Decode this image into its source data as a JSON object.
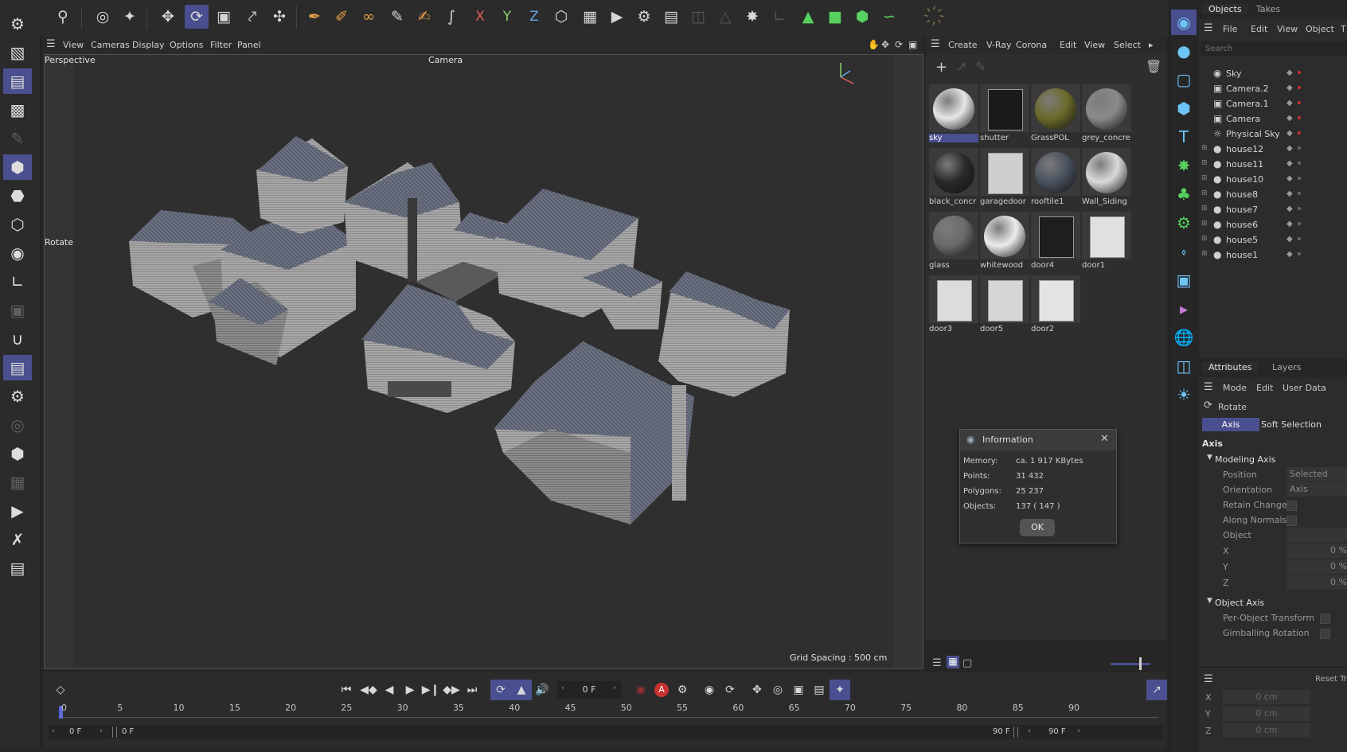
{
  "colors": {
    "accent": "#4a4f8f",
    "bg": "#262626",
    "panel": "#2e2e2e",
    "icon_blue": "#6ec3f5",
    "record_red": "#c8322f"
  },
  "top_toolbar": {
    "icons": [
      "search-icon",
      "live-selection-icon",
      "select-tools-icon",
      "move-icon",
      "rotate-icon",
      "scale-icon",
      "transfer-icon",
      "point-move-icon",
      "spline-pen-icon",
      "spline-paint-icon",
      "spline-arc-icon",
      "brush-icon",
      "sculpt-icon",
      "knife-icon",
      "x-axis-icon",
      "y-axis-icon",
      "z-axis-icon",
      "world-coord-icon",
      "render-region-icon",
      "render-view-icon",
      "render-settings-icon",
      "picture-viewer-icon",
      "snap-icon",
      "workplane-icon",
      "lock-icon",
      "dynamics-icon",
      "camera-icon",
      "cube-icon",
      "spline-icon",
      "geometry-icon",
      "deformer-icon",
      "figure-icon"
    ],
    "xyz": [
      "X",
      "Y",
      "Z"
    ]
  },
  "viewport": {
    "menu": [
      "View",
      "Cameras",
      "Display",
      "Options",
      "Filter",
      "Panel"
    ],
    "view_name": "Perspective",
    "camera_label": "Camera",
    "tool_label": "Rotate",
    "grid_spacing": "Grid Spacing : 500 cm"
  },
  "material_manager": {
    "menu": [
      "Create",
      "V-Ray",
      "Corona",
      "Edit",
      "View",
      "Select"
    ],
    "materials": [
      {
        "name": "sky",
        "color": "#e6e6e6",
        "selected": true
      },
      {
        "name": "shutter",
        "color": "#1a1a1a"
      },
      {
        "name": "GrassPOL",
        "color": "#6b6a2a"
      },
      {
        "name": "grey_concre",
        "color": "#8a8a8a"
      },
      {
        "name": "black_concr",
        "color": "#2a2a2a"
      },
      {
        "name": "garagedoor",
        "color": "#cfcfcf"
      },
      {
        "name": "rooftile1",
        "color": "#4a525e"
      },
      {
        "name": "Wall_Siding",
        "color": "#d9d9d9"
      },
      {
        "name": "glass",
        "color": "#6a6a6a"
      },
      {
        "name": "whitewood",
        "color": "#ececec"
      },
      {
        "name": "door4",
        "color": "#1e1e1e"
      },
      {
        "name": "door1",
        "color": "#e0e0e0"
      },
      {
        "name": "door3",
        "color": "#dcdcdc"
      },
      {
        "name": "door5",
        "color": "#d6d6d6"
      },
      {
        "name": "door2",
        "color": "#e4e4e4"
      }
    ]
  },
  "info_dialog": {
    "title": "Information",
    "rows": [
      {
        "label": "Memory:",
        "value": "ca. 1 917 KBytes"
      },
      {
        "label": "Points:",
        "value": "31 432"
      },
      {
        "label": "Polygons:",
        "value": "25 237"
      },
      {
        "label": "Objects:",
        "value": "137 ( 147 )"
      }
    ],
    "ok_label": "OK"
  },
  "objects_panel": {
    "tabs": [
      "Objects",
      "Takes"
    ],
    "menu": [
      "File",
      "Edit",
      "View",
      "Object",
      "T"
    ],
    "search_placeholder": "Search",
    "items": [
      {
        "name": "Sky",
        "icon": "sky-icon"
      },
      {
        "name": "Camera.2",
        "icon": "camera-icon"
      },
      {
        "name": "Camera.1",
        "icon": "camera-icon"
      },
      {
        "name": "Camera",
        "icon": "camera-icon"
      },
      {
        "name": "Physical Sky",
        "icon": "physical-sky-icon"
      },
      {
        "name": "house12",
        "icon": "null-icon",
        "expandable": true
      },
      {
        "name": "house11",
        "icon": "null-icon",
        "expandable": true
      },
      {
        "name": "house10",
        "icon": "null-icon",
        "expandable": true
      },
      {
        "name": "house8",
        "icon": "null-icon",
        "expandable": true
      },
      {
        "name": "house7",
        "icon": "null-icon",
        "expandable": true
      },
      {
        "name": "house6",
        "icon": "null-icon",
        "expandable": true
      },
      {
        "name": "house5",
        "icon": "null-icon",
        "expandable": true
      },
      {
        "name": "house1",
        "icon": "null-icon",
        "expandable": true
      }
    ]
  },
  "attributes_panel": {
    "tabs": [
      "Attributes",
      "Layers"
    ],
    "menu": [
      "Mode",
      "Edit",
      "User Data"
    ],
    "tool_name": "Rotate",
    "subtabs": [
      "Axis",
      "Soft Selection"
    ],
    "section": "Axis",
    "modeling_axis": {
      "title": "Modeling Axis",
      "position_label": "Position",
      "position_value": "Selected",
      "orientation_label": "Orientation",
      "orientation_value": "Axis",
      "retain_changes": "Retain Changes",
      "along_normals": "Along Normals",
      "object_label": "Object",
      "x_label": "X",
      "y_label": "Y",
      "z_label": "Z",
      "x_value": "0 %",
      "y_value": "0 %",
      "z_value": "0 %"
    },
    "object_axis": {
      "title": "Object Axis",
      "per_object": "Per-Object Transform",
      "gimballing": "Gimballing Rotation"
    },
    "coords": {
      "reset": "Reset Tr",
      "x": "X",
      "y": "Y",
      "z": "Z",
      "x_val": "0 cm",
      "y_val": "0 cm",
      "z_val": "0 cm"
    }
  },
  "timeline": {
    "current_frame": "0 F",
    "ticks": [
      "0",
      "5",
      "10",
      "15",
      "20",
      "25",
      "30",
      "35",
      "40",
      "45",
      "50",
      "55",
      "60",
      "65",
      "70",
      "75",
      "80",
      "85",
      "90"
    ],
    "start": "0 F",
    "range_start": "0 F",
    "range_end": "90 F",
    "end": "90 F",
    "record_label": "A"
  }
}
